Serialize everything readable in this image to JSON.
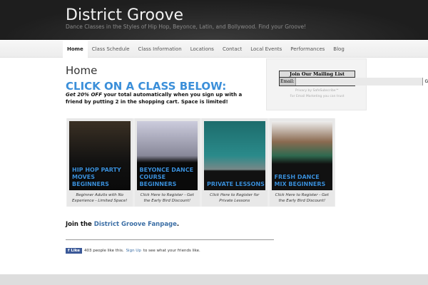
{
  "header": {
    "title": "District Groove",
    "tagline": "Dance Classes in the Styles of Hip Hop, Beyonce, Latin, and Bollywood. Find your Groove!"
  },
  "nav": {
    "items": [
      "Home",
      "Class Schedule",
      "Class Information",
      "Locations",
      "Contact",
      "Local Events",
      "Performances",
      "Blog"
    ]
  },
  "main": {
    "title": "Home",
    "cta": "CLICK ON A CLASS BELOW:",
    "promo_em": "Get 20% OFF",
    "promo_rest": " your total automatically when you sign up with a friend by putting 2 in the shopping cart. Space is limited!",
    "cards": [
      {
        "title": "HIP HOP PARTY MOVES BEGINNERS",
        "caption": "Beginner Adults with No Experience - Limited Space!"
      },
      {
        "title": "BEYONCE DANCE COURSE BEGINNERS",
        "caption": "Click Here to Register - Get the Early Bird Discount!"
      },
      {
        "title": "PRIVATE LESSONS",
        "caption": "Click Here to Register for Private Lessons"
      },
      {
        "title": "FRESH DANCE MIX BEGINNERS",
        "caption": "Click Here to Register - Get the Early Bird Discount!"
      }
    ],
    "fan_prefix": "Join the ",
    "fan_link": "District Groove Fanpage",
    "fan_suffix": ".",
    "fb": {
      "button": "Like",
      "count_text": "403 people like this.",
      "signup": "Sign Up",
      "rest": "to see what your friends like."
    }
  },
  "mailing": {
    "heading": "Join Our Mailing List",
    "email_label": "Email:",
    "go": "Go",
    "privacy": "Privacy by SafeSubscribe℠",
    "note": "For Email Marketing you can trust"
  }
}
